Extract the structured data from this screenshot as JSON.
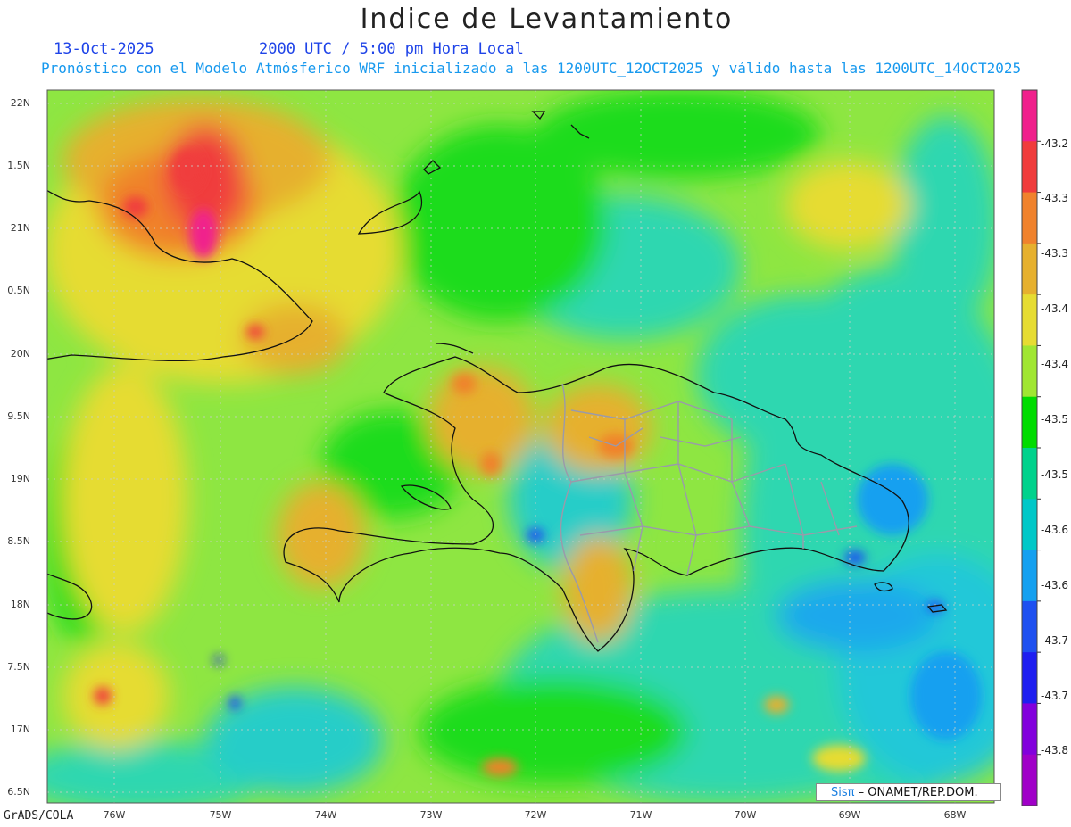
{
  "title": "Indice de Levantamiento",
  "date": "13-Oct-2025",
  "time": "2000 UTC / 5:00 pm Hora Local",
  "forecast_line": "Pronóstico con el Modelo Atmósferico WRF inicializado a las 1200UTC_12OCT2025 y válido hasta las  1200UTC_14OCT2025",
  "lat_labels": [
    "22N",
    "1.5N",
    "21N",
    "0.5N",
    "20N",
    "9.5N",
    "19N",
    "8.5N",
    "18N",
    "7.5N",
    "17N",
    "6.5N"
  ],
  "lon_labels": [
    "76W",
    "75W",
    "74W",
    "73W",
    "72W",
    "71W",
    "70W",
    "69W",
    "68W"
  ],
  "colorbar_labels": [
    "-43.2",
    "-43.3",
    "-43.3",
    "-43.4",
    "-43.4",
    "-43.5",
    "-43.5",
    "-43.6",
    "-43.6",
    "-43.7",
    "-43.7",
    "-43.8"
  ],
  "colorbar_colors": [
    "#f0208c",
    "#f03c3c",
    "#f0822c",
    "#e6b02e",
    "#e6dc32",
    "#a0e632",
    "#00dc00",
    "#00d28c",
    "#00c8c8",
    "#14a0f0",
    "#1e50f0",
    "#1e1ef0",
    "#8200dc",
    "#a000c8"
  ],
  "credit": "GrADS/COLA",
  "footer_brand": "Sisπ",
  "footer_org": "– ONAMET/REP.DOM."
}
